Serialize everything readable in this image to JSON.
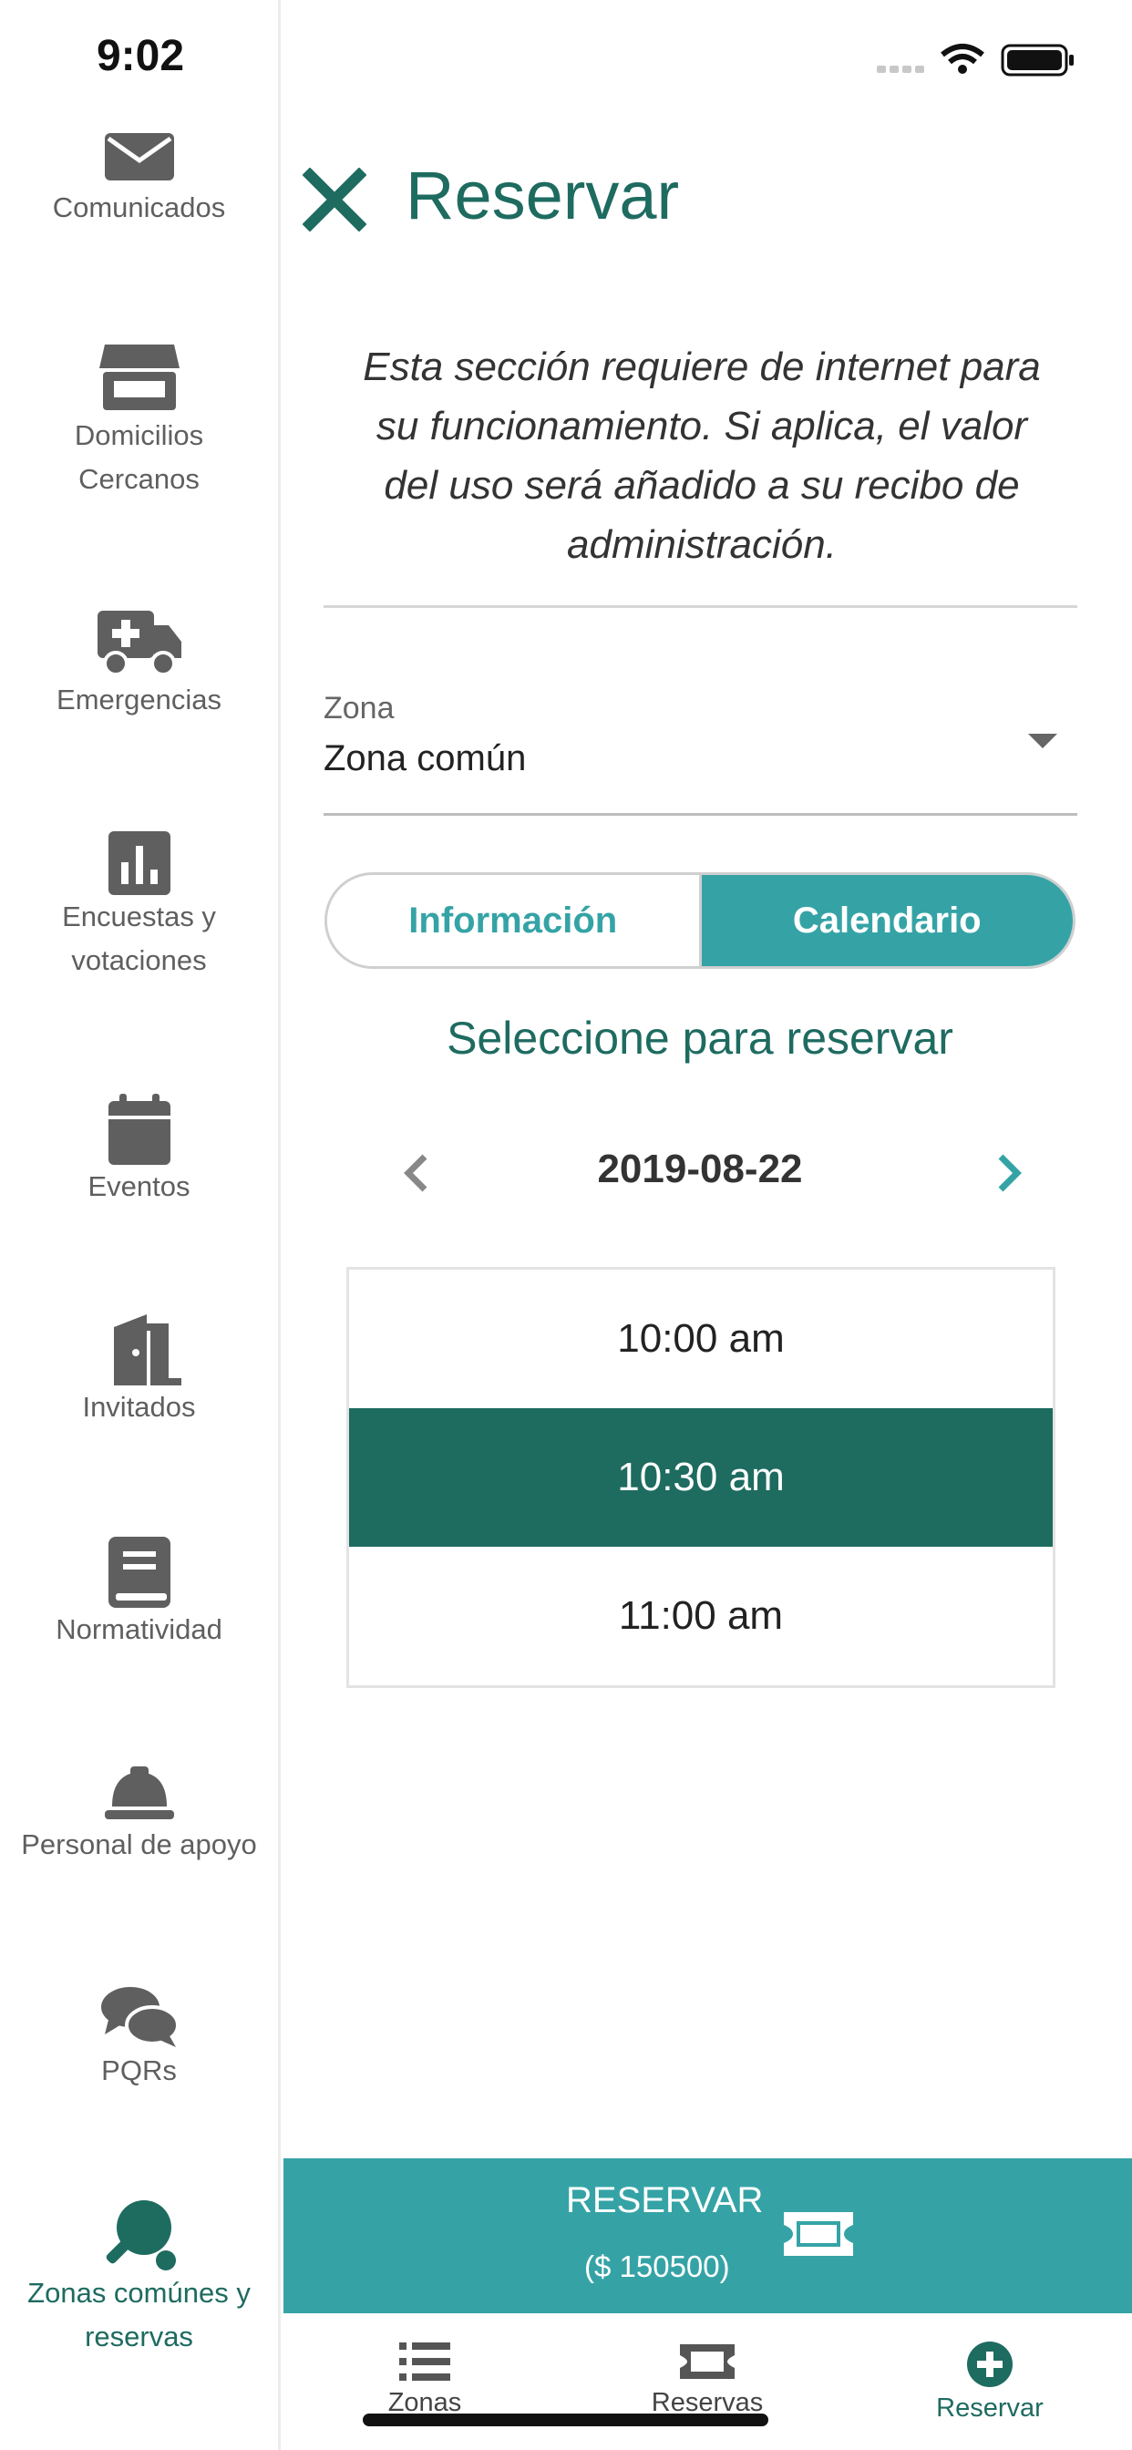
{
  "status_bar": {
    "time": "9:02"
  },
  "sidebar": {
    "items": [
      {
        "label": "Comunicados",
        "icon": "envelope-icon"
      },
      {
        "label": "Domicilios Cercanos",
        "icon": "store-icon"
      },
      {
        "label": "Emergencias",
        "icon": "ambulance-icon"
      },
      {
        "label": "Encuestas y votaciones",
        "icon": "poll-icon"
      },
      {
        "label": "Eventos",
        "icon": "calendar-icon"
      },
      {
        "label": "Invitados",
        "icon": "door-icon"
      },
      {
        "label": "Normatividad",
        "icon": "book-icon"
      },
      {
        "label": "Personal de apoyo",
        "icon": "hard-hat-icon"
      },
      {
        "label": "PQRs",
        "icon": "comments-icon"
      },
      {
        "label": "Zonas comúnes y reservas",
        "icon": "ping-pong-icon"
      }
    ]
  },
  "header": {
    "title": "Reservar"
  },
  "notice": "Esta sección requiere de internet para su funcionamiento. Si aplica, el valor del uso será añadido a su recibo de administración.",
  "zona": {
    "label": "Zona",
    "value": "Zona común"
  },
  "segmented": {
    "info_label": "Información",
    "calendar_label": "Calendario",
    "selected": "Calendario"
  },
  "select_title": "Seleccione para reservar",
  "date": {
    "value": "2019-08-22"
  },
  "slots": [
    {
      "time": "10:00 am",
      "selected": false
    },
    {
      "time": "10:30 am",
      "selected": true
    },
    {
      "time": "11:00 am",
      "selected": false
    }
  ],
  "reserve": {
    "label": "RESERVAR",
    "price": "($ 150500)"
  },
  "tabs": [
    {
      "label": "Zonas",
      "icon": "list-icon"
    },
    {
      "label": "Reservas",
      "icon": "ticket-icon"
    },
    {
      "label": "Reservar",
      "icon": "plus-circle-icon"
    }
  ],
  "colors": {
    "primary_dark": "#1e6b60",
    "accent": "#35a3a6",
    "icon_gray": "#5f5f5f"
  }
}
